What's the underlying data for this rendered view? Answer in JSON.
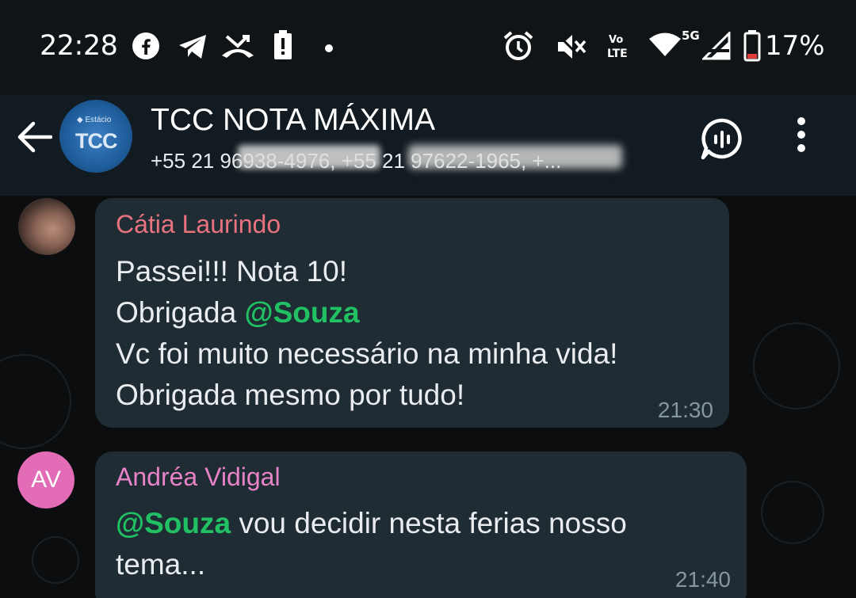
{
  "status_bar": {
    "time": "22:28",
    "battery": "17%",
    "network": "5G",
    "volte": "Vo LTE",
    "icons": [
      "facebook-icon",
      "telegram-icon",
      "missed-call-icon",
      "alert-icon",
      "dot-icon",
      "alarm-icon",
      "mute-icon",
      "volte-icon",
      "wifi-icon",
      "signal-icon",
      "battery-icon"
    ]
  },
  "header": {
    "title": "TCC NOTA MÁXIMA",
    "subtitle": "+55 21 96938-4976, +55 21 97622-1965, +...",
    "avatar_text": "TCC",
    "avatar_brand": "◆ Estácio"
  },
  "messages": [
    {
      "sender": "Cátia Laurindo",
      "lines": [
        {
          "text": "Passei!!! Nota 10!"
        },
        {
          "prefix": "Obrigada ",
          "mention": "@Souza"
        },
        {
          "text": "Vc foi muito necessário na minha vida!"
        },
        {
          "text": "Obrigada mesmo por tudo!"
        }
      ],
      "time": "21:30"
    },
    {
      "sender": "Andréa Vidigal",
      "avatar_initials": "AV",
      "mention": "@Souza",
      "line1_rest": " vou decidir nesta ferias nosso",
      "line2": "tema...",
      "time": "21:40"
    }
  ],
  "colors": {
    "bubble": "#1f2c34",
    "mention": "#21c063",
    "sender1": "#e8737f",
    "sender2": "#e883c8",
    "av_bg": "#e36cb6"
  }
}
